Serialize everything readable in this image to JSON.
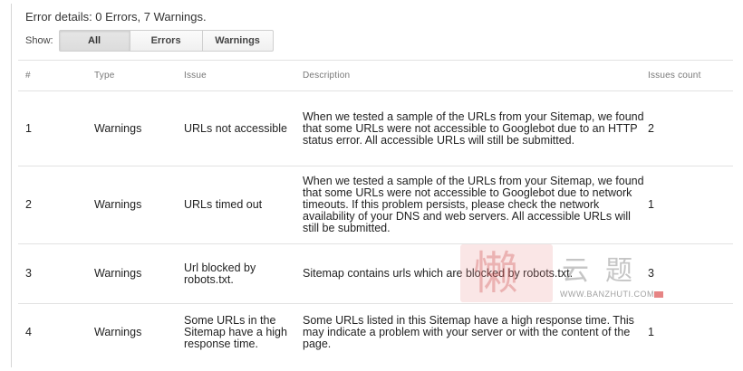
{
  "header": {
    "title": "Error details: 0 Errors, 7 Warnings."
  },
  "filter": {
    "label": "Show:",
    "options": [
      "All",
      "Errors",
      "Warnings"
    ],
    "selected": "All"
  },
  "table": {
    "columns": [
      "#",
      "Type",
      "Issue",
      "Description",
      "Issues count"
    ],
    "rows": [
      {
        "num": "1",
        "type": "Warnings",
        "issue": "URLs not accessible",
        "description": "When we tested a sample of the URLs from your Sitemap, we found that some URLs were not accessible to Googlebot due to an HTTP status error. All accessible URLs will still be submitted.",
        "count": "2"
      },
      {
        "num": "2",
        "type": "Warnings",
        "issue": "URLs timed out",
        "description": "When we tested a sample of the URLs from your Sitemap, we found that some URLs were not accessible to Googlebot due to network timeouts. If this problem persists, please check the network availability of your DNS and web servers. All accessible URLs will still be submitted.",
        "count": "1"
      },
      {
        "num": "3",
        "type": "Warnings",
        "issue": "Url blocked by robots.txt.",
        "description": "Sitemap contains urls which are blocked by robots.txt.",
        "count": "3"
      },
      {
        "num": "4",
        "type": "Warnings",
        "issue": "Some URLs in the Sitemap have a high response time.",
        "description": "Some URLs listed in this Sitemap have a high response time. This may indicate a problem with your server or with the content of the page.",
        "count": "1"
      }
    ]
  },
  "watermark": {
    "glyph": "懒",
    "brand": "云题",
    "url": "WWW.BANZHUTI.COM"
  },
  "colors": {
    "border": "#e2e2e2",
    "header_text": "#777777",
    "selected_button": "#e0e0e0"
  }
}
